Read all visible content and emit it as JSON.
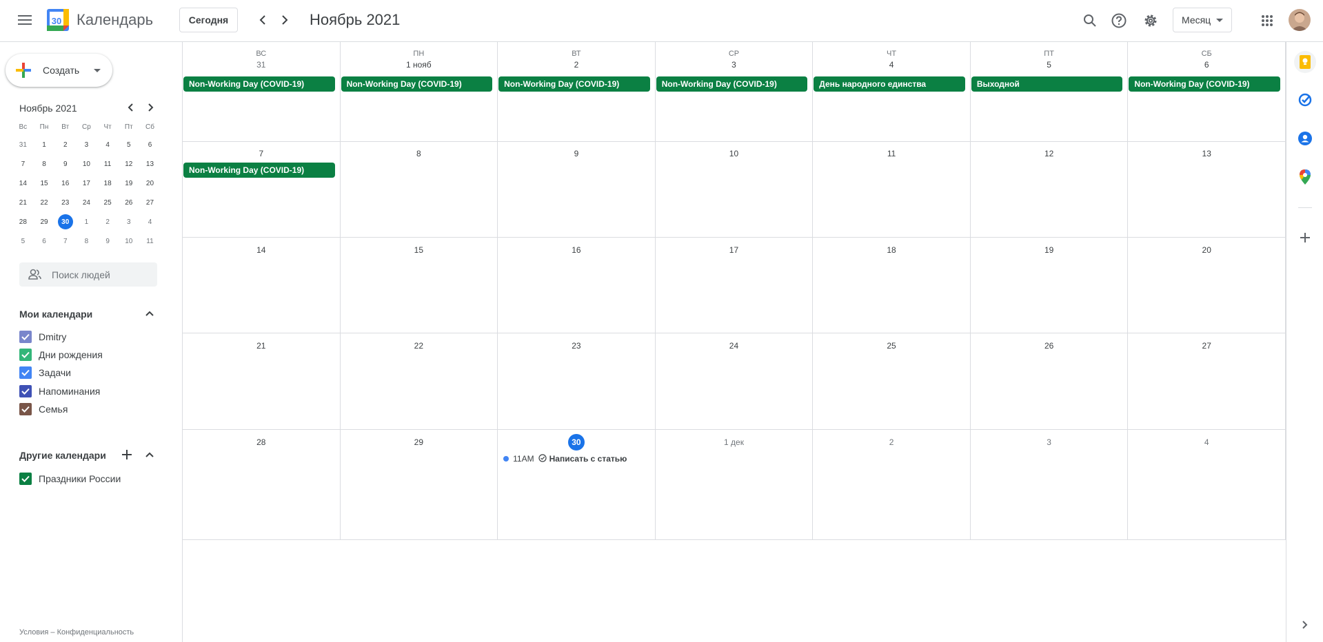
{
  "header": {
    "app_title": "Календарь",
    "logo_day": "30",
    "today_label": "Сегодня",
    "month_title": "Ноябрь 2021",
    "view_label": "Месяц",
    "icons": [
      "menu-icon",
      "chevron-left-icon",
      "chevron-right-icon",
      "search-icon",
      "help-icon",
      "gear-icon",
      "apps-icon"
    ]
  },
  "sidebar": {
    "create_label": "Создать",
    "mini_calendar": {
      "title": "Ноябрь 2021",
      "weekdays": [
        "Вс",
        "Пн",
        "Вт",
        "Ср",
        "Чт",
        "Пт",
        "Сб"
      ],
      "weeks": [
        [
          "31",
          "1",
          "2",
          "3",
          "4",
          "5",
          "6"
        ],
        [
          "7",
          "8",
          "9",
          "10",
          "11",
          "12",
          "13"
        ],
        [
          "14",
          "15",
          "16",
          "17",
          "18",
          "19",
          "20"
        ],
        [
          "21",
          "22",
          "23",
          "24",
          "25",
          "26",
          "27"
        ],
        [
          "28",
          "29",
          "30",
          "1",
          "2",
          "3",
          "4"
        ],
        [
          "5",
          "6",
          "7",
          "8",
          "9",
          "10",
          "11"
        ]
      ],
      "today": "30"
    },
    "people_search_placeholder": "Поиск людей",
    "my_calendars_title": "Мои календари",
    "my_calendars": [
      {
        "label": "Dmitry",
        "color": "#7986cb"
      },
      {
        "label": "Дни рождения",
        "color": "#33b679"
      },
      {
        "label": "Задачи",
        "color": "#4285f4"
      },
      {
        "label": "Напоминания",
        "color": "#3f51b5"
      },
      {
        "label": "Семья",
        "color": "#795548"
      }
    ],
    "other_calendars_title": "Другие календари",
    "other_calendars": [
      {
        "label": "Праздники России",
        "color": "#0b8043"
      }
    ],
    "footer": "Условия – Конфиденциальность"
  },
  "calendar": {
    "weekdays": [
      "ВС",
      "ПН",
      "ВТ",
      "СР",
      "ЧТ",
      "ПТ",
      "СБ"
    ],
    "event_color": "#0b8043",
    "today_color": "#1a73e8",
    "weeks": [
      [
        {
          "label": "31",
          "other": true,
          "events": [
            "Non-Working Day (COVID-19)"
          ]
        },
        {
          "label": "1 нояб",
          "events": [
            "Non-Working Day (COVID-19)"
          ]
        },
        {
          "label": "2",
          "events": [
            "Non-Working Day (COVID-19)"
          ]
        },
        {
          "label": "3",
          "events": [
            "Non-Working Day (COVID-19)"
          ]
        },
        {
          "label": "4",
          "events": [
            "День народного единства"
          ]
        },
        {
          "label": "5",
          "events": [
            "Выходной"
          ]
        },
        {
          "label": "6",
          "events": [
            "Non-Working Day (COVID-19)"
          ]
        }
      ],
      [
        {
          "label": "7",
          "events": [
            "Non-Working Day (COVID-19)"
          ]
        },
        {
          "label": "8",
          "events": []
        },
        {
          "label": "9",
          "events": []
        },
        {
          "label": "10",
          "events": []
        },
        {
          "label": "11",
          "events": []
        },
        {
          "label": "12",
          "events": []
        },
        {
          "label": "13",
          "events": []
        }
      ],
      [
        {
          "label": "14",
          "events": []
        },
        {
          "label": "15",
          "events": []
        },
        {
          "label": "16",
          "events": []
        },
        {
          "label": "17",
          "events": []
        },
        {
          "label": "18",
          "events": []
        },
        {
          "label": "19",
          "events": []
        },
        {
          "label": "20",
          "events": []
        }
      ],
      [
        {
          "label": "21",
          "events": []
        },
        {
          "label": "22",
          "events": []
        },
        {
          "label": "23",
          "events": []
        },
        {
          "label": "24",
          "events": []
        },
        {
          "label": "25",
          "events": []
        },
        {
          "label": "26",
          "events": []
        },
        {
          "label": "27",
          "events": []
        }
      ],
      [
        {
          "label": "28",
          "events": []
        },
        {
          "label": "29",
          "events": []
        },
        {
          "label": "30",
          "today": true,
          "events": [],
          "timed": [
            {
              "time": "11AM",
              "title": "Написать с статью"
            }
          ]
        },
        {
          "label": "1 дек",
          "other": true,
          "events": []
        },
        {
          "label": "2",
          "other": true,
          "events": []
        },
        {
          "label": "3",
          "other": true,
          "events": []
        },
        {
          "label": "4",
          "other": true,
          "events": []
        }
      ]
    ]
  },
  "right_rail": {
    "icons": [
      "keep-icon",
      "tasks-icon",
      "contacts-icon",
      "maps-icon",
      "add-icon",
      "expand-icon"
    ]
  }
}
